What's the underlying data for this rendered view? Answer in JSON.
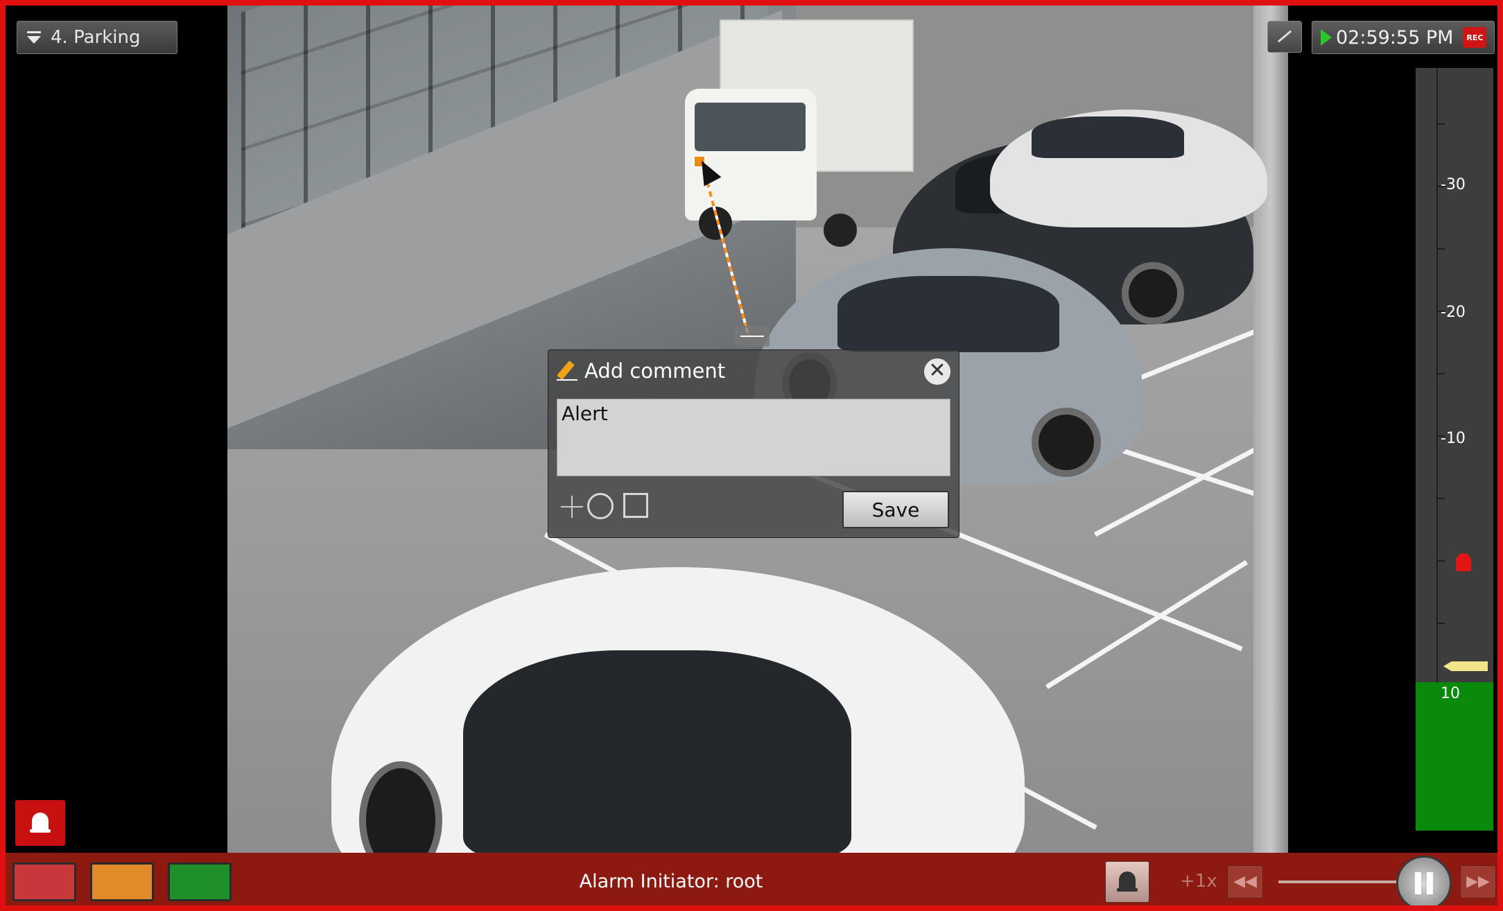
{
  "camera": {
    "title": "4. Parking"
  },
  "status": {
    "time": "02:59:55 PM",
    "rec_badge": "REC"
  },
  "timeline": {
    "labels": [
      "-30",
      "-20",
      "-10",
      "10"
    ]
  },
  "dialog": {
    "title": "Add comment",
    "comment_value": "Alert",
    "save_label": "Save",
    "close_glyph": "✕",
    "tools": [
      "point-tool-icon",
      "circle-tool-icon",
      "rectangle-tool-icon"
    ]
  },
  "bottom_bar": {
    "alarm_initiator": "Alarm Initiator: root",
    "speed": "+1x",
    "rewind_glyph": "◀◀",
    "forward_glyph": "▶▶"
  },
  "colors": {
    "frame": "#e01010",
    "alarm_swatches": [
      "#c8383a",
      "#e08a2a",
      "#1f8f2a"
    ],
    "timeline_green": "#0a8a0a"
  }
}
